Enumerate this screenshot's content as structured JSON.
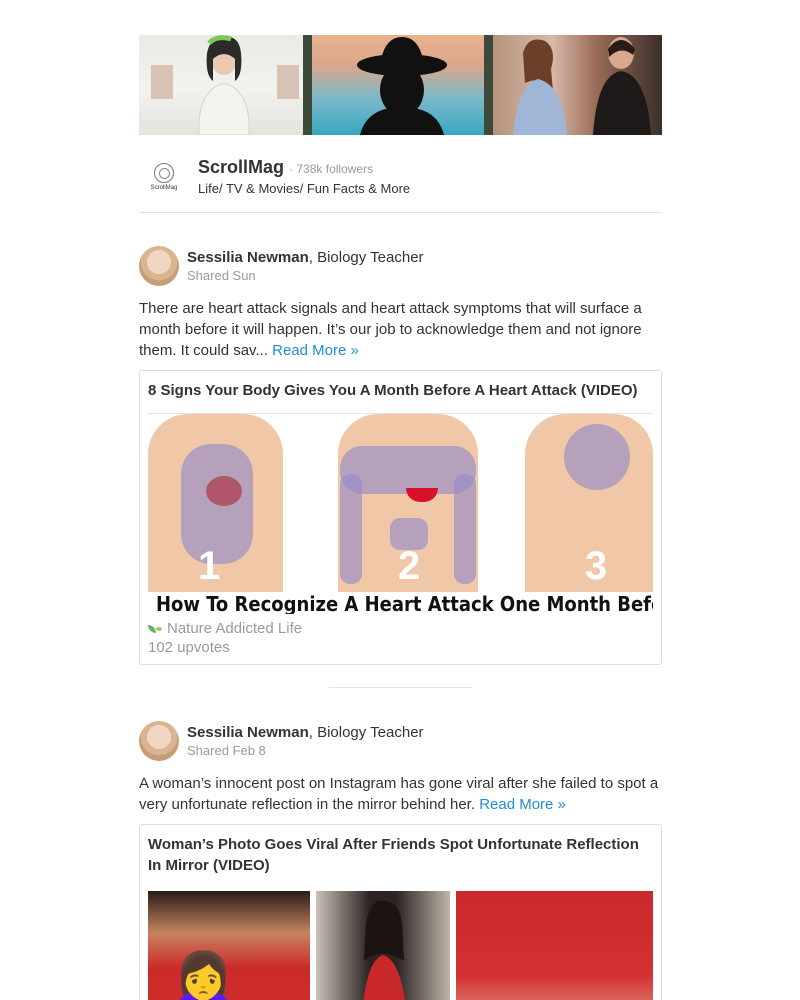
{
  "publication": {
    "name": "ScrollMag",
    "logo_text": "ScrollMag",
    "followers": "· 738k followers",
    "categories": "Life/ TV & Movies/ Fun Facts & More"
  },
  "posts": [
    {
      "author_name": "Sessilia Newman",
      "author_title": ", Biology Teacher",
      "shared": "Shared Sun",
      "text": "There are heart attack signals and heart attack symptoms that will surface a month before it will happen. It’s our job to acknowledge them and not ignore them. It could sav...",
      "read_more": "Read More »",
      "card": {
        "title": "8 Signs Your Body Gives You A Month Before A Heart Attack (VIDEO)",
        "image_numbers": [
          "1",
          "2",
          "3"
        ],
        "image_caption": "How To Recognize A Heart Attack One Month Before It Happens",
        "source": "Nature Addicted Life",
        "upvotes": "102 upvotes"
      }
    },
    {
      "author_name": "Sessilia Newman",
      "author_title": ", Biology Teacher",
      "shared": "Shared Feb 8",
      "text": "A woman’s innocent post on Instagram has gone viral after she failed to spot a very unfortunate reflection in the mirror behind her.",
      "read_more": "Read More »",
      "card": {
        "title": "Woman’s Photo Goes Viral After Friends Spot Unfortunate Reflection In Mirror (VIDEO)",
        "emoji": "🙍‍♀️"
      }
    }
  ]
}
